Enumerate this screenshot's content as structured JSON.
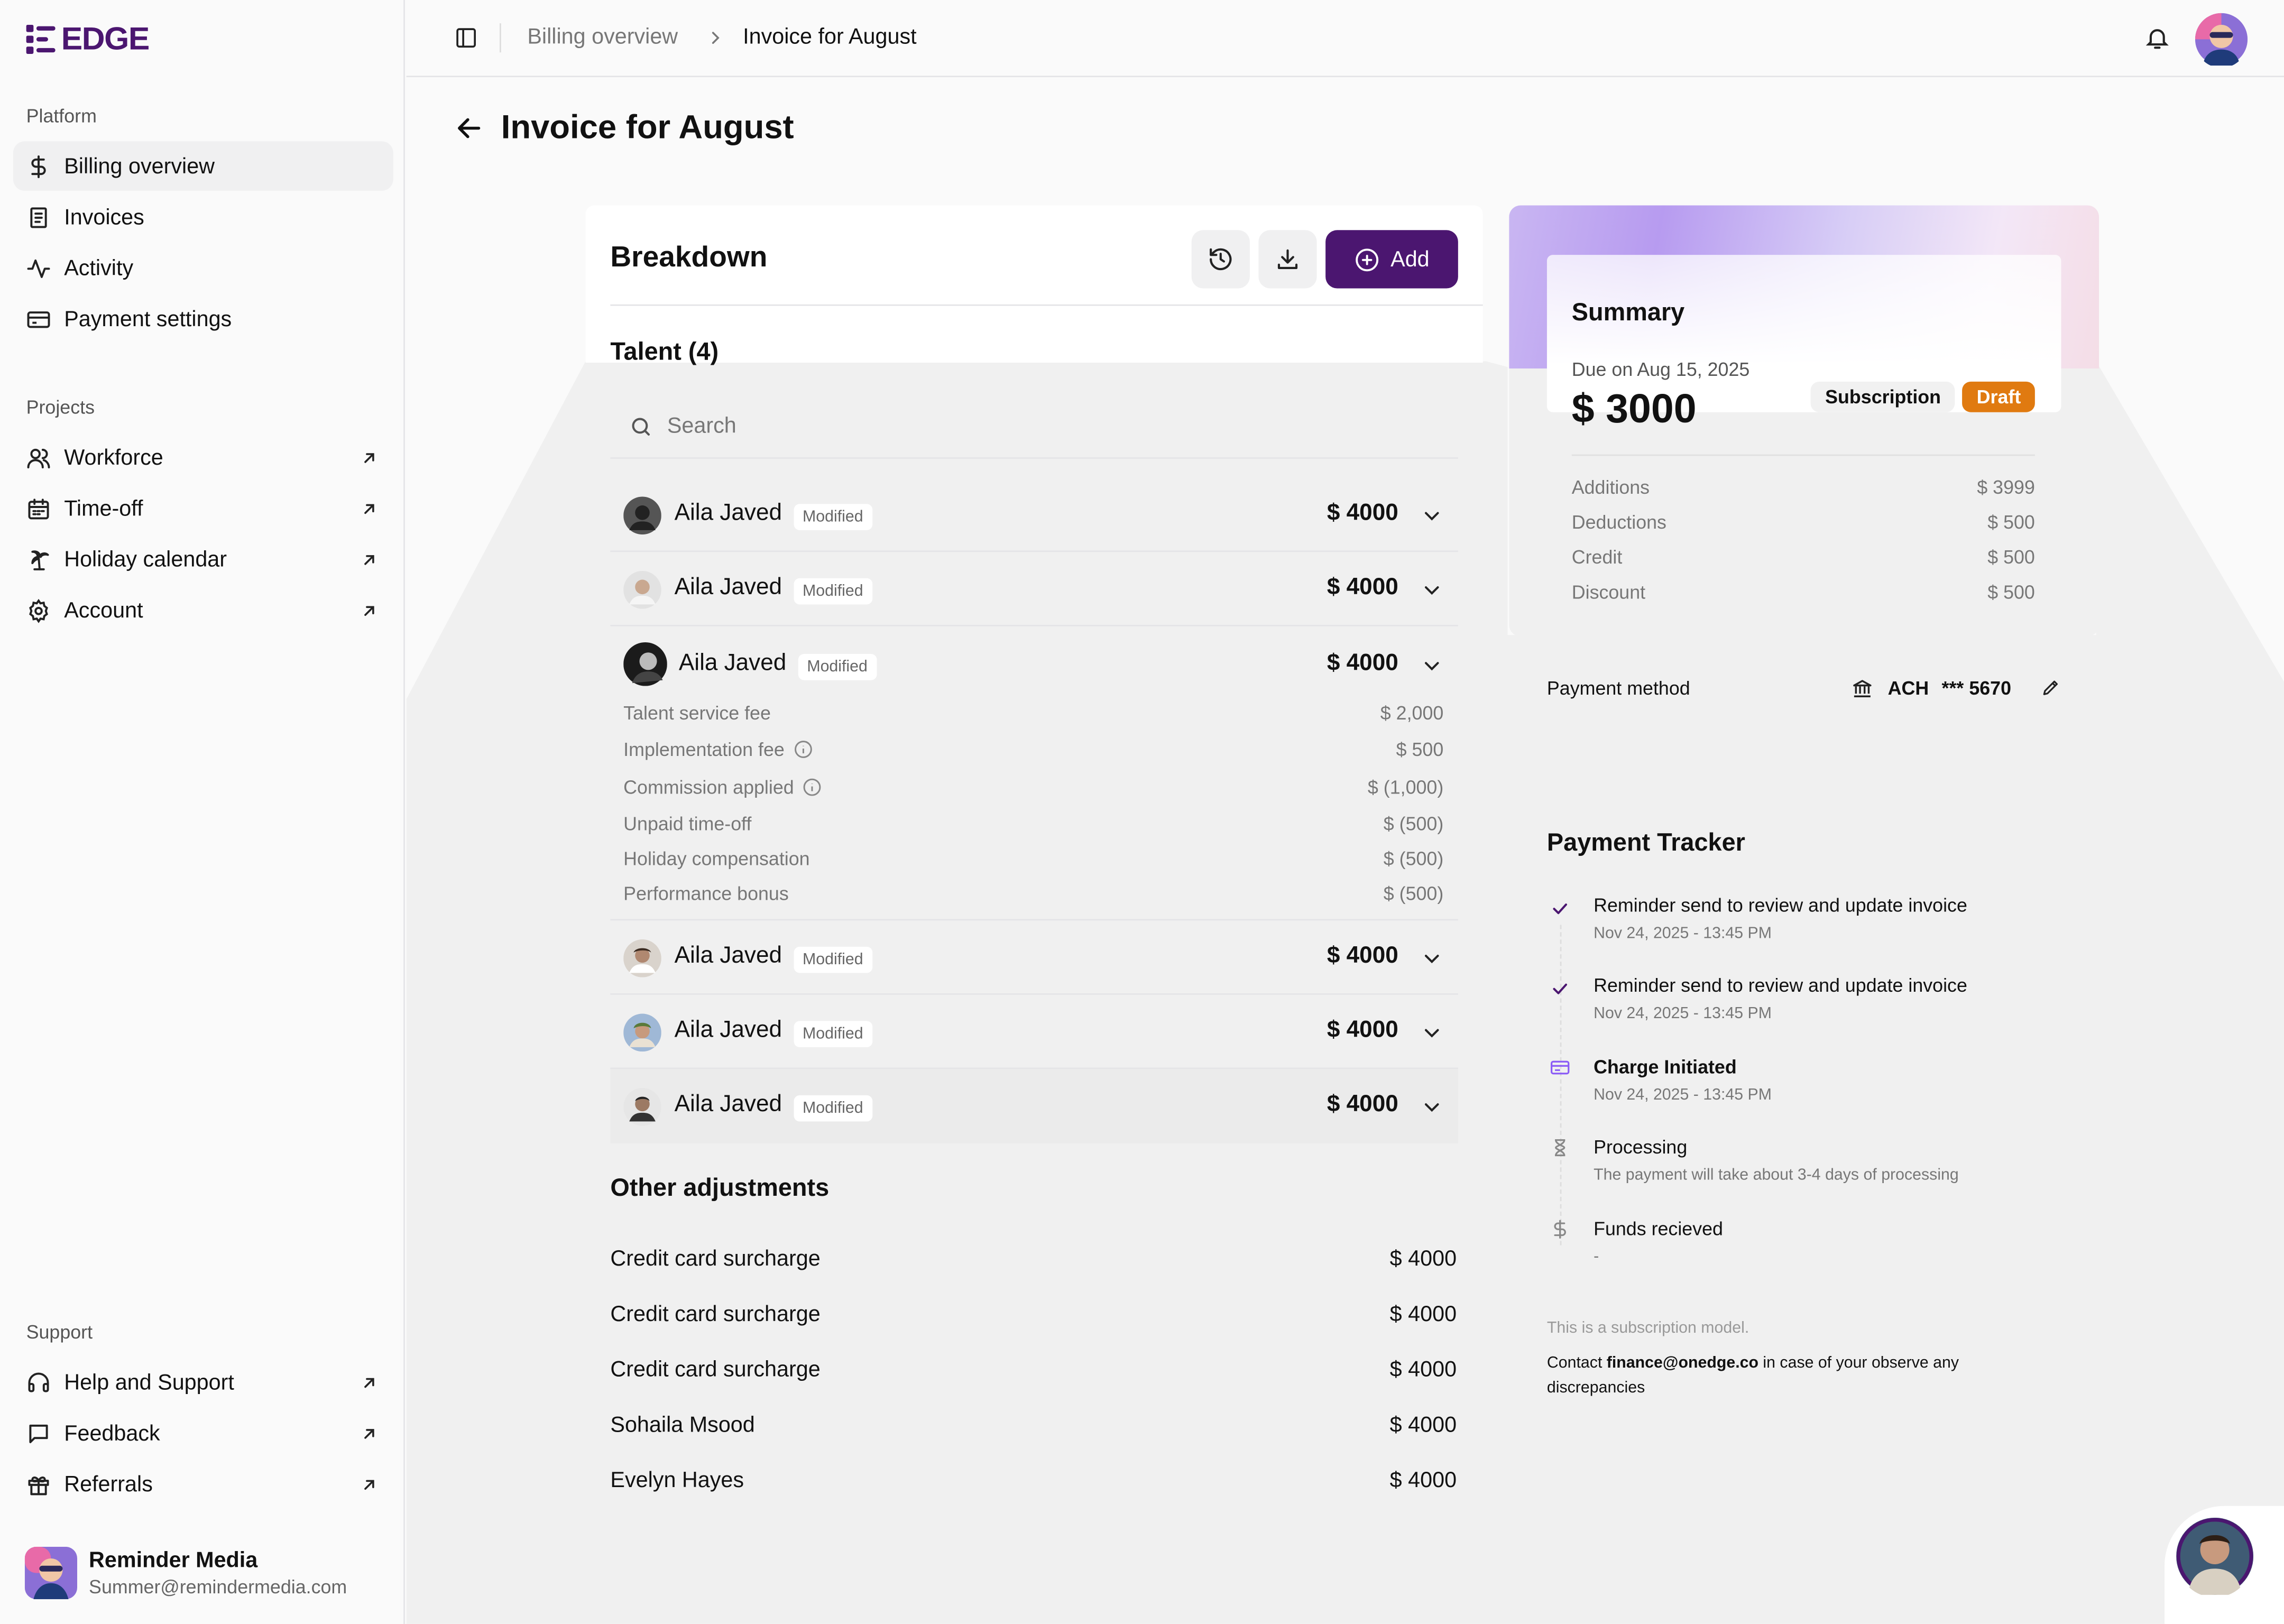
{
  "brand": {
    "name": "EDGE",
    "accent": "#4b1670"
  },
  "sidebar": {
    "platform_label": "Platform",
    "platform_items": [
      {
        "label": "Billing overview",
        "icon": "dollar-icon",
        "active": true
      },
      {
        "label": "Invoices",
        "icon": "receipt-icon"
      },
      {
        "label": "Activity",
        "icon": "activity-icon"
      },
      {
        "label": "Payment settings",
        "icon": "credit-card-icon"
      }
    ],
    "projects_label": "Projects",
    "project_items": [
      {
        "label": "Workforce",
        "icon": "users-icon"
      },
      {
        "label": "Time-off",
        "icon": "calendar-icon"
      },
      {
        "label": "Holiday calendar",
        "icon": "palm-tree-icon"
      },
      {
        "label": "Account",
        "icon": "gear-icon"
      }
    ],
    "support_label": "Support",
    "support_items": [
      {
        "label": "Help and Support",
        "icon": "headset-icon"
      },
      {
        "label": "Feedback",
        "icon": "message-icon"
      },
      {
        "label": "Referrals",
        "icon": "gift-icon"
      }
    ],
    "user": {
      "name": "Reminder Media",
      "email": "Summer@remindermedia.com"
    }
  },
  "topbar": {
    "crumb_parent": "Billing overview",
    "crumb_current": "Invoice for August"
  },
  "page": {
    "title": "Invoice for August"
  },
  "breakdown": {
    "title": "Breakdown",
    "add_label": "Add",
    "talent_heading": "Talent (4)",
    "search_placeholder": "Search",
    "modified_label": "Modified",
    "talent": [
      {
        "name": "Aila Javed",
        "amount": "$ 4000"
      },
      {
        "name": "Aila Javed",
        "amount": "$ 4000"
      },
      {
        "name": "Aila Javed",
        "amount": "$ 4000"
      },
      {
        "name": "Aila Javed",
        "amount": "$ 4000"
      },
      {
        "name": "Aila Javed",
        "amount": "$ 4000"
      },
      {
        "name": "Aila Javed",
        "amount": "$ 4000"
      }
    ],
    "expanded_lines": [
      {
        "label": "Talent service fee",
        "value": "$ 2,000"
      },
      {
        "label": "Implementation fee",
        "value": "$ 500"
      },
      {
        "label": "Commission applied",
        "value": "$ (1,000)"
      },
      {
        "label": "Unpaid time-off",
        "value": "$ (500)"
      },
      {
        "label": "Holiday compensation",
        "value": "$ (500)"
      },
      {
        "label": "Performance bonus",
        "value": "$ (500)"
      }
    ],
    "other_heading": "Other adjustments",
    "other": [
      {
        "label": "Credit card surcharge",
        "value": "$ 4000"
      },
      {
        "label": "Credit card surcharge",
        "value": "$ 4000"
      },
      {
        "label": "Credit card surcharge",
        "value": "$ 4000"
      },
      {
        "label": "Sohaila Msood",
        "value": "$ 4000"
      },
      {
        "label": "Evelyn Hayes",
        "value": "$ 4000"
      }
    ]
  },
  "summary": {
    "title": "Summary",
    "due": "Due on Aug 15, 2025",
    "total": "$ 3000",
    "subscription_tag": "Subscription",
    "status": "Draft",
    "status_color": "#e07a10",
    "lines": [
      {
        "label": "Additions",
        "value": "$ 3999"
      },
      {
        "label": "Deductions",
        "value": "$ 500"
      },
      {
        "label": "Credit",
        "value": "$ 500"
      },
      {
        "label": "Discount",
        "value": "$ 500"
      }
    ],
    "payment_method_label": "Payment method",
    "payment_method_type": "ACH",
    "payment_method_num": "*** 5670"
  },
  "tracker": {
    "title": "Payment Tracker",
    "steps": [
      {
        "title": "Reminder send to review and update invoice",
        "time": "Nov 24, 2025 - 13:45 PM",
        "icon": "check-icon"
      },
      {
        "title": "Reminder send to review and update invoice",
        "time": "Nov 24, 2025 - 13:45 PM",
        "icon": "check-icon"
      },
      {
        "title": "Charge Initiated",
        "time": "Nov 24, 2025 - 13:45 PM",
        "icon": "card-icon"
      },
      {
        "title": "Processing",
        "time": "The payment will take about 3-4 days of processing",
        "icon": "hourglass-icon"
      },
      {
        "title": "Funds recieved",
        "time": "-",
        "icon": "dollar-icon"
      }
    ],
    "note1": "This is a subscription model.",
    "note2_pre": "Contact ",
    "note2_email": "finance@onedge.co",
    "note2_post": " in case of your observe any discrepancies"
  }
}
